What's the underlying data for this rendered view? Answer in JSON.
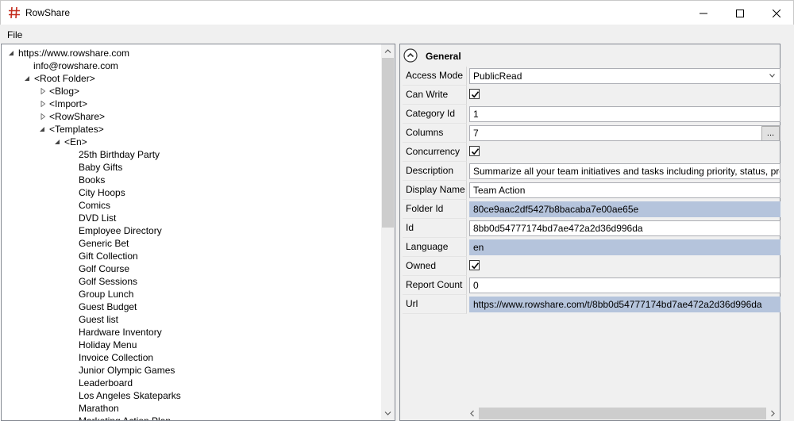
{
  "window": {
    "title": "RowShare",
    "minimize_label": "",
    "accent": "#c42b1c"
  },
  "menu": {
    "file": "File"
  },
  "tree": {
    "root_url": "https://www.rowshare.com",
    "account": "info@rowshare.com",
    "root_folder": "<Root Folder>",
    "folders": [
      "<Blog>",
      "<Import>",
      "<RowShare>",
      "<Templates>"
    ],
    "language_folder": "<En>",
    "templates": [
      "25th Birthday Party",
      "Baby Gifts",
      "Books",
      "City Hoops",
      "Comics",
      "DVD List",
      "Employee Directory",
      "Generic Bet",
      "Gift Collection",
      "Golf Course",
      "Golf Sessions",
      "Group Lunch",
      "Guest Budget",
      "Guest list",
      "Hardware Inventory",
      "Holiday Menu",
      "Invoice Collection",
      "Junior Olympic Games",
      "Leaderboard",
      "Los Angeles Skateparks",
      "Marathon",
      "Marketing Action Plan"
    ]
  },
  "properties": {
    "category": "General",
    "ellipsis": "...",
    "rows": [
      {
        "name": "Access Mode",
        "kind": "combo",
        "value": "PublicRead"
      },
      {
        "name": "Can Write",
        "kind": "check",
        "value": "true"
      },
      {
        "name": "Category Id",
        "kind": "text",
        "value": "1"
      },
      {
        "name": "Columns",
        "kind": "button",
        "value": "7"
      },
      {
        "name": "Concurrency",
        "kind": "check",
        "value": "true"
      },
      {
        "name": "Description",
        "kind": "text",
        "value": "Summarize all your team initiatives and tasks including priority, status, progress"
      },
      {
        "name": "Display Name",
        "kind": "text",
        "value": "Team Action"
      },
      {
        "name": "Folder Id",
        "kind": "selected",
        "value": "80ce9aac2df5427b8bacaba7e00ae65e"
      },
      {
        "name": "Id",
        "kind": "text",
        "value": "8bb0d54777174bd7ae472a2d36d996da"
      },
      {
        "name": "Language",
        "kind": "selected",
        "value": "en"
      },
      {
        "name": "Owned",
        "kind": "check",
        "value": "true"
      },
      {
        "name": "Report Count",
        "kind": "text",
        "value": "0"
      },
      {
        "name": "Url",
        "kind": "selected",
        "value": "https://www.rowshare.com/t/8bb0d54777174bd7ae472a2d36d996da"
      }
    ]
  }
}
